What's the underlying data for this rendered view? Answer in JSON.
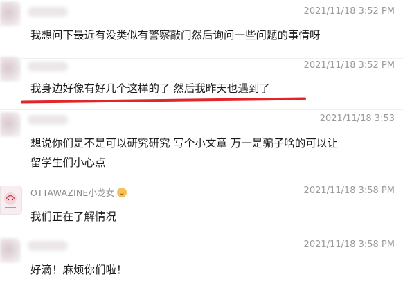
{
  "messages": [
    {
      "sender": "",
      "time": "2021/11/18 3:52 PM",
      "lines": [
        "我想问下最近有没类似有警察敲门然后询问一些问题的事情呀"
      ]
    },
    {
      "sender": "",
      "time": "2021/11/18 3:52 PM",
      "lines": [
        "我身边好像有好几个这样的了 然后我昨天也遇到了"
      ]
    },
    {
      "sender": "",
      "time": "2021/11/18 3:53",
      "lines": [
        "想说你们是不是可以研究研究 写个小文章 万一是骗子啥的可以让",
        "留学生们小心点"
      ]
    },
    {
      "sender": "OTTAWAZINE小龙女",
      "time": "2021/11/18 3:58 PM",
      "lines": [
        "我们正在了解情况"
      ]
    },
    {
      "sender": "",
      "time": "2021/11/18 3:58 PM",
      "lines": [
        "好滴！麻烦你们啦！"
      ]
    }
  ],
  "colors": {
    "highlight": "#e0262b",
    "timestamp": "#9b9b9b"
  }
}
